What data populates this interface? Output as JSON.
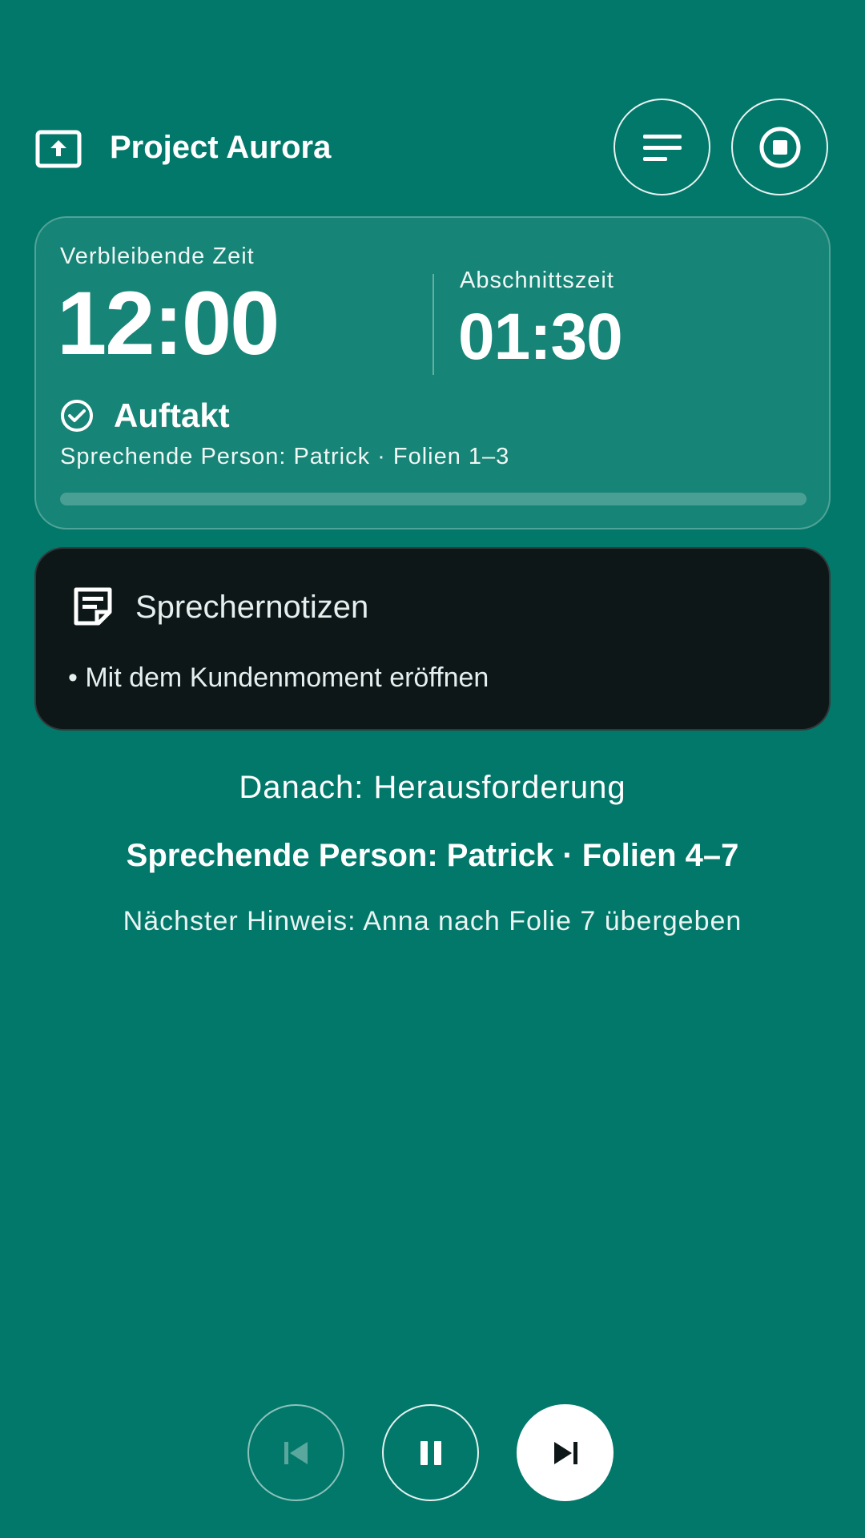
{
  "header": {
    "title": "Project Aurora",
    "icons": {
      "app": "present-upload-icon",
      "menu": "menu-lines-icon",
      "stop": "stop-icon"
    }
  },
  "timer": {
    "remaining_label": "Verbleibende Zeit",
    "remaining_value": "12:00",
    "section_label": "Abschnittszeit",
    "section_value": "01:30",
    "segment_name": "Auftakt",
    "segment_meta": "Sprechende Person: Patrick · Folien 1–3",
    "progress_fraction": 0
  },
  "notes": {
    "title": "Sprechernotizen",
    "bullet": "• Mit dem Kundenmoment eröffnen"
  },
  "next": {
    "title": "Danach: Herausforderung",
    "meta": "Sprechende Person: Patrick · Folien 4–7",
    "cue": "Nächster Hinweis: Anna nach Folie 7 übergeben"
  },
  "controls": {
    "icons": [
      "skip-previous-icon",
      "pause-icon",
      "skip-next-icon"
    ],
    "previous_enabled": false
  },
  "colors": {
    "background": "#02786A",
    "card": "#168476",
    "notes_card": "#0E1718",
    "accent": "#FFFFFF"
  }
}
